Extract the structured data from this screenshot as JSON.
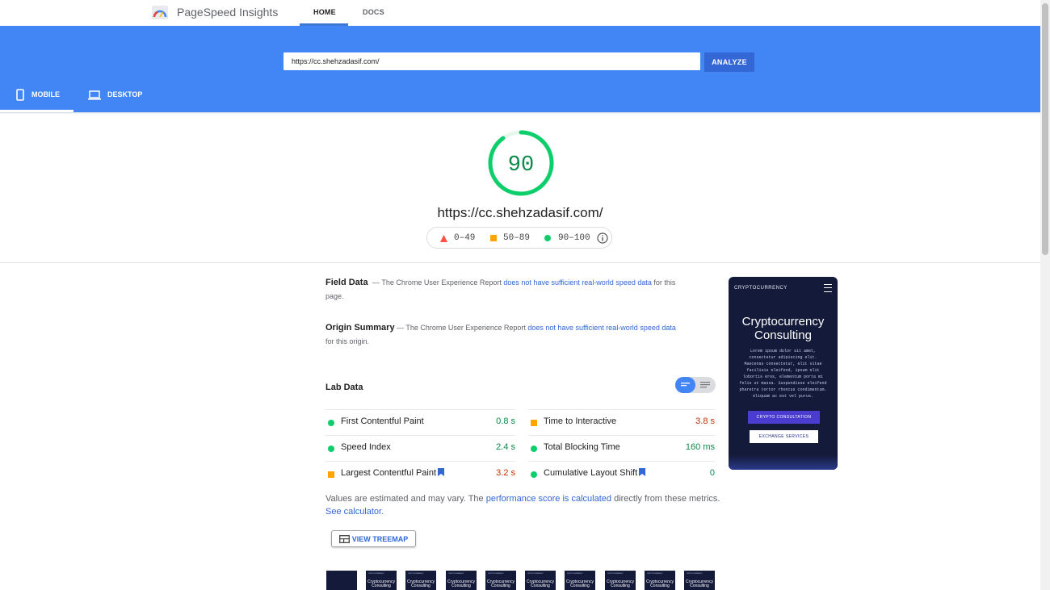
{
  "header": {
    "app_title": "PageSpeed Insights",
    "tabs": [
      {
        "label": "HOME",
        "active": true
      },
      {
        "label": "DOCS",
        "active": false
      }
    ]
  },
  "search": {
    "value": "https://cc.shehzadasif.com/",
    "analyze_label": "ANALYZE"
  },
  "device_tabs": [
    {
      "label": "MOBILE",
      "active": true
    },
    {
      "label": "DESKTOP",
      "active": false
    }
  ],
  "score": {
    "value": "90",
    "fraction": 0.9,
    "url": "https://cc.shehzadasif.com/",
    "color": "#0cce6b"
  },
  "legend": [
    {
      "range": "0–49",
      "color": "#ff4e42",
      "shape": "triangle"
    },
    {
      "range": "50–89",
      "color": "#ffa400",
      "shape": "square"
    },
    {
      "range": "90–100",
      "color": "#0cce6b",
      "shape": "circle"
    }
  ],
  "field_data": {
    "title": "Field Data",
    "text_before": "— The Chrome User Experience Report ",
    "link": "does not have sufficient real-world speed data",
    "text_after": " for this page."
  },
  "origin_summary": {
    "title": "Origin Summary",
    "text_before": "— The Chrome User Experience Report ",
    "link": "does not have sufficient real-world speed data",
    "text_after": " for this origin."
  },
  "lab_data": {
    "title": "Lab Data",
    "metrics": [
      {
        "label": "First Contentful Paint",
        "value": "0.8 s",
        "status": "good"
      },
      {
        "label": "Time to Interactive",
        "value": "3.8 s",
        "status": "average"
      },
      {
        "label": "Speed Index",
        "value": "2.4 s",
        "status": "good"
      },
      {
        "label": "Total Blocking Time",
        "value": "160 ms",
        "status": "good"
      },
      {
        "label": "Largest Contentful Paint",
        "value": "3.2 s",
        "status": "average"
      },
      {
        "label": "Cumulative Layout Shift",
        "value": "0",
        "status": "good"
      }
    ],
    "footnote_before": "Values are estimated and may vary. The ",
    "footnote_link1": "performance score is calculated",
    "footnote_middle": " directly from these metrics. ",
    "footnote_link2": "See calculator.",
    "treemap_label": "VIEW TREEMAP"
  },
  "colors": {
    "good": "#0cce6b",
    "average": "#ffa400",
    "good_text": "#0a8a4a",
    "average_text": "#c33300",
    "accent": "#4285f4"
  },
  "screenshot": {
    "brand": "CRYPTOCURRENCY",
    "title_line1": "Cryptocurrency",
    "title_line2": "Consulting",
    "body": "Lorem ipsum dolor sit amet, consectetur adipiscing elit. Maecenas consectetur, elit vitae facilisis eleifend, ipsum elit lobortis eros, elementum porta mi felis ut massa. Suspendisse eleifend pharetra tortor rhoncus condimentum. Aliquam ac est vel purus.",
    "cta_primary": "CRYPTO CONSULTATION",
    "cta_secondary": "EXCHANGE SERVICES"
  },
  "filmstrip": {
    "frame_brand": "CRYPTOCURRENCY",
    "frame_title_line1": "Cryptocurrency",
    "frame_title_line2": "Consulting"
  }
}
